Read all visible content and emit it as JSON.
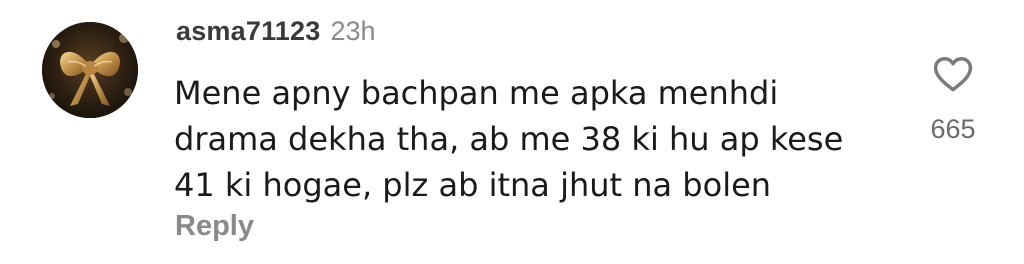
{
  "comment": {
    "avatar_icon": "gold-bow-avatar",
    "username": "asma71123",
    "timestamp": "23h",
    "text": "Mene apny bachpan me apka menhdi\ndrama dekha tha, ab me 38 ki hu ap kese\n41 ki hogae, plz ab itna jhut na bolen",
    "reply_label": "Reply",
    "like_icon": "heart-outline-icon",
    "like_count": "665"
  },
  "colors": {
    "username": "#3a3a3a",
    "timestamp": "#8a8a8a",
    "text": "#1a1a1a",
    "reply": "#8a8a8a",
    "like_count": "#6a6a6a",
    "background": "#ffffff"
  }
}
